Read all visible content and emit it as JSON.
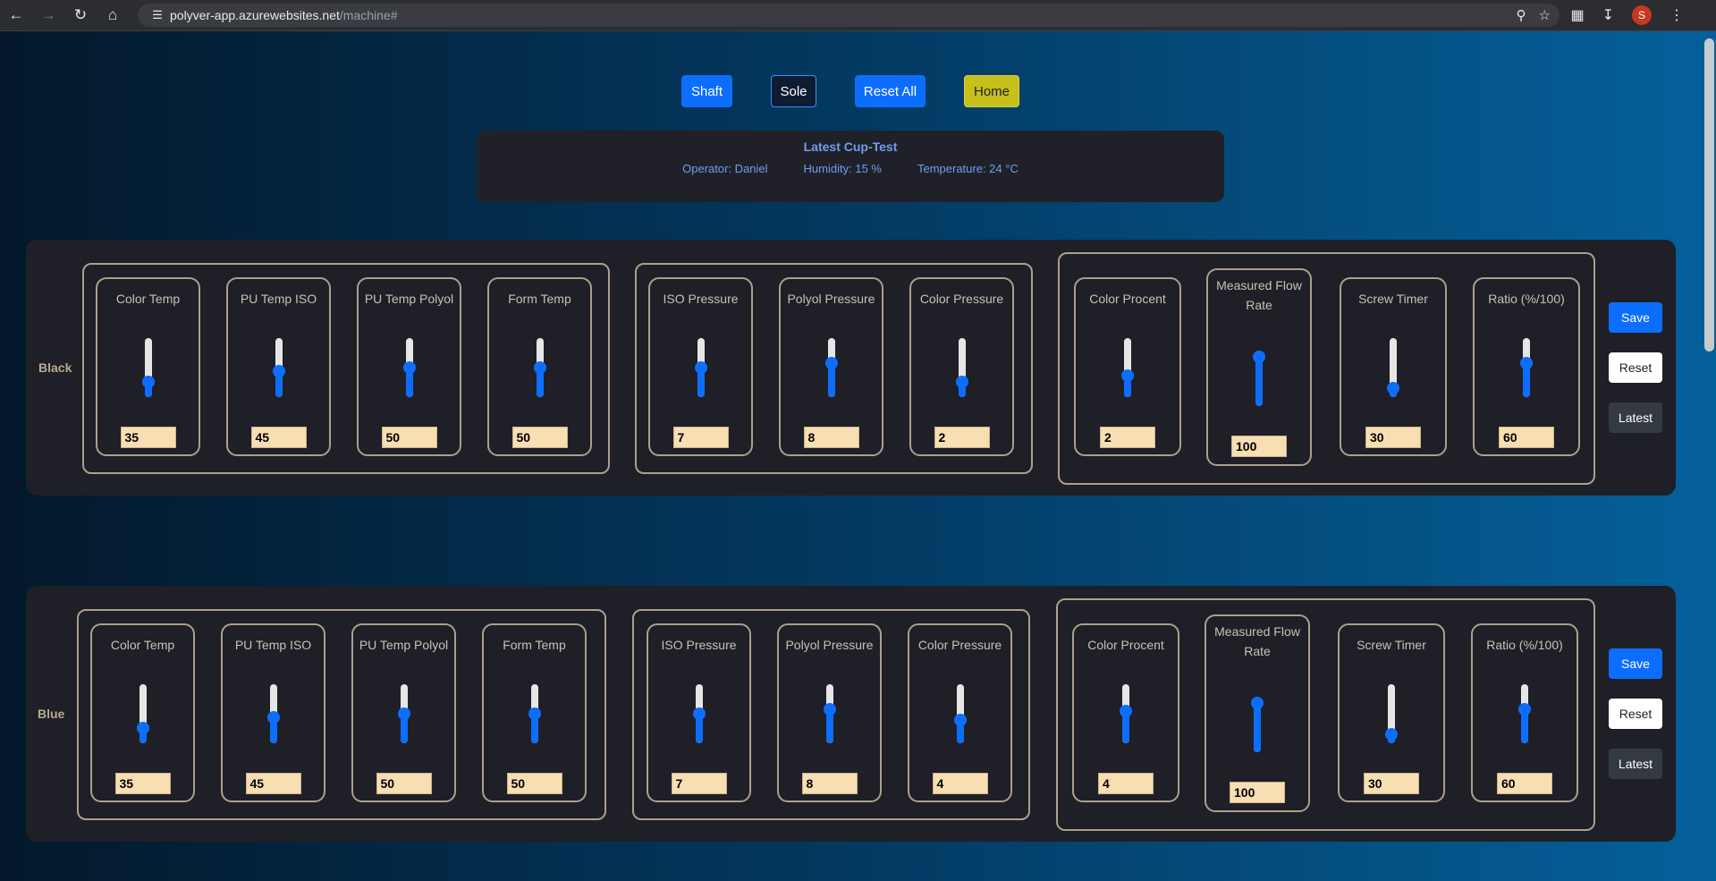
{
  "browser": {
    "url_host": "polyver-app.azurewebsites.net",
    "url_path": "/machine#",
    "profile_initial": "S"
  },
  "nav": {
    "shaft": "Shaft",
    "sole": "Sole",
    "reset_all": "Reset All",
    "home": "Home"
  },
  "cup_test": {
    "title": "Latest Cup-Test",
    "operator": "Operator: Daniel",
    "humidity": "Humidity: 15 %",
    "temperature": "Temperature: 24 °C"
  },
  "actions": {
    "save": "Save",
    "reset": "Reset",
    "latest": "Latest"
  },
  "panels": [
    {
      "name": "Black",
      "controls": [
        {
          "label": "Color Temp",
          "value": "35",
          "level": 0.2
        },
        {
          "label": "PU Temp ISO",
          "value": "45",
          "level": 0.42
        },
        {
          "label": "PU Temp Polyol",
          "value": "50",
          "level": 0.5
        },
        {
          "label": "Form Temp",
          "value": "50",
          "level": 0.5
        },
        {
          "label": "ISO Pressure",
          "value": "7",
          "level": 0.5
        },
        {
          "label": "Polyol Pressure",
          "value": "8",
          "level": 0.6
        },
        {
          "label": "Color Pressure",
          "value": "2",
          "level": 0.2
        },
        {
          "label": "Color Procent",
          "value": "2",
          "level": 0.32
        },
        {
          "label": "Measured Flow Rate",
          "value": "100",
          "level": 1.0
        },
        {
          "label": "Screw Timer",
          "value": "30",
          "level": 0.06
        },
        {
          "label": "Ratio (%/100)",
          "value": "60",
          "level": 0.6
        }
      ]
    },
    {
      "name": "Blue",
      "controls": [
        {
          "label": "Color Temp",
          "value": "35",
          "level": 0.2
        },
        {
          "label": "PU Temp ISO",
          "value": "45",
          "level": 0.42
        },
        {
          "label": "PU Temp Polyol",
          "value": "50",
          "level": 0.5
        },
        {
          "label": "Form Temp",
          "value": "50",
          "level": 0.5
        },
        {
          "label": "ISO Pressure",
          "value": "7",
          "level": 0.5
        },
        {
          "label": "Polyol Pressure",
          "value": "8",
          "level": 0.6
        },
        {
          "label": "Color Pressure",
          "value": "4",
          "level": 0.36
        },
        {
          "label": "Color Procent",
          "value": "4",
          "level": 0.56
        },
        {
          "label": "Measured Flow Rate",
          "value": "100",
          "level": 1.0
        },
        {
          "label": "Screw Timer",
          "value": "30",
          "level": 0.06
        },
        {
          "label": "Ratio (%/100)",
          "value": "60",
          "level": 0.6
        }
      ]
    }
  ]
}
